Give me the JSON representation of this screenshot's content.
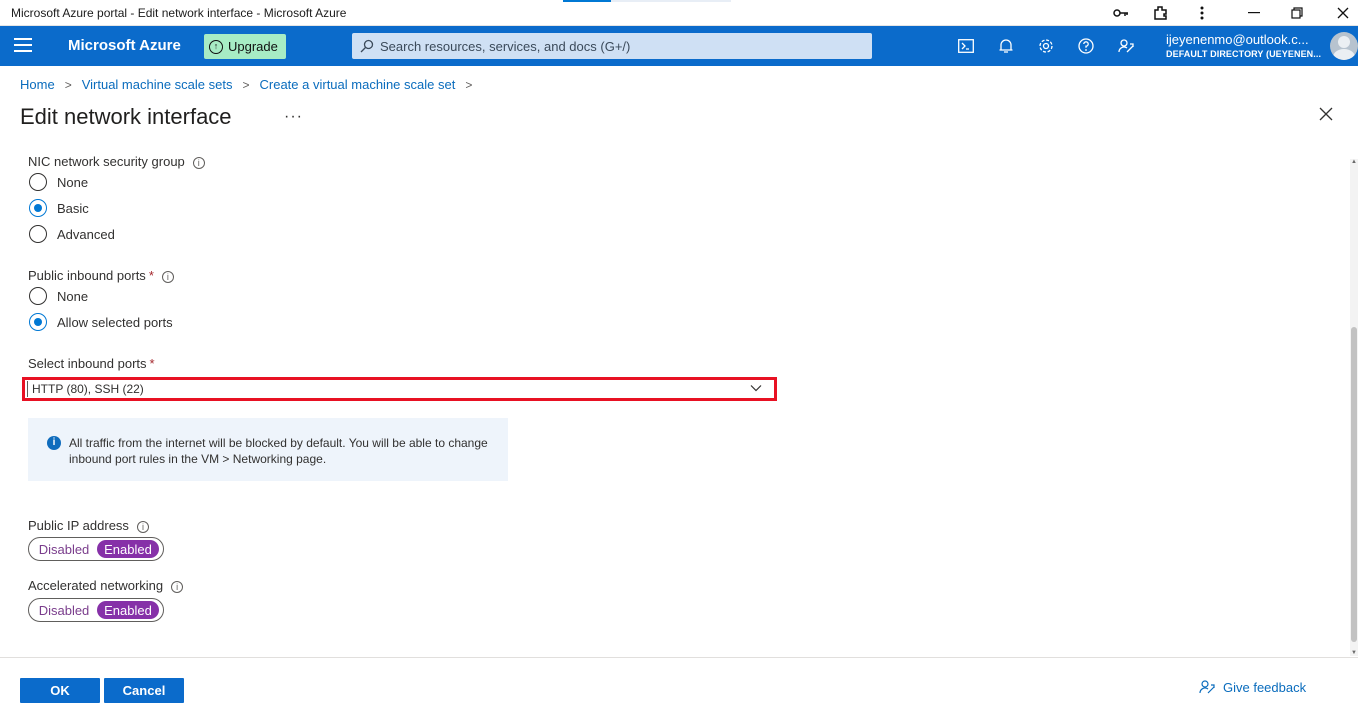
{
  "window": {
    "title": "Microsoft Azure portal - Edit network interface - Microsoft Azure"
  },
  "topbar": {
    "brand": "Microsoft Azure",
    "upgrade_label": "Upgrade",
    "search_placeholder": "Search resources, services, and docs (G+/)",
    "user_email": "ijeyenenmo@outlook.c...",
    "user_directory": "DEFAULT DIRECTORY (UEYENEN..."
  },
  "breadcrumb": [
    "Home",
    "Virtual machine scale sets",
    "Create a virtual machine scale set"
  ],
  "page": {
    "title": "Edit network interface",
    "more": "···"
  },
  "nic_nsg": {
    "label": "NIC network security group",
    "options": [
      "None",
      "Basic",
      "Advanced"
    ],
    "selected": "Basic"
  },
  "public_inbound": {
    "label": "Public inbound ports",
    "required": "*",
    "options": [
      "None",
      "Allow selected ports"
    ],
    "selected": "Allow selected ports"
  },
  "select_inbound": {
    "label": "Select inbound ports",
    "required": "*",
    "value": "HTTP (80), SSH (22)"
  },
  "info_message": "All traffic from the internet will be blocked by default. You will be able to change inbound port rules in the VM > Networking page.",
  "public_ip": {
    "label": "Public IP address",
    "off_label": "Disabled",
    "on_label": "Enabled",
    "value": "Enabled"
  },
  "accelerated": {
    "label": "Accelerated networking",
    "off_label": "Disabled",
    "on_label": "Enabled",
    "value": "Enabled"
  },
  "footer": {
    "ok_label": "OK",
    "cancel_label": "Cancel",
    "feedback_label": "Give feedback"
  },
  "colors": {
    "azure_blue": "#0b6bcb",
    "link_blue": "#0a6cbd",
    "highlight_red": "#e81123",
    "toggle_purple": "#8631a8",
    "upgrade_green": "#a7ecc5"
  }
}
